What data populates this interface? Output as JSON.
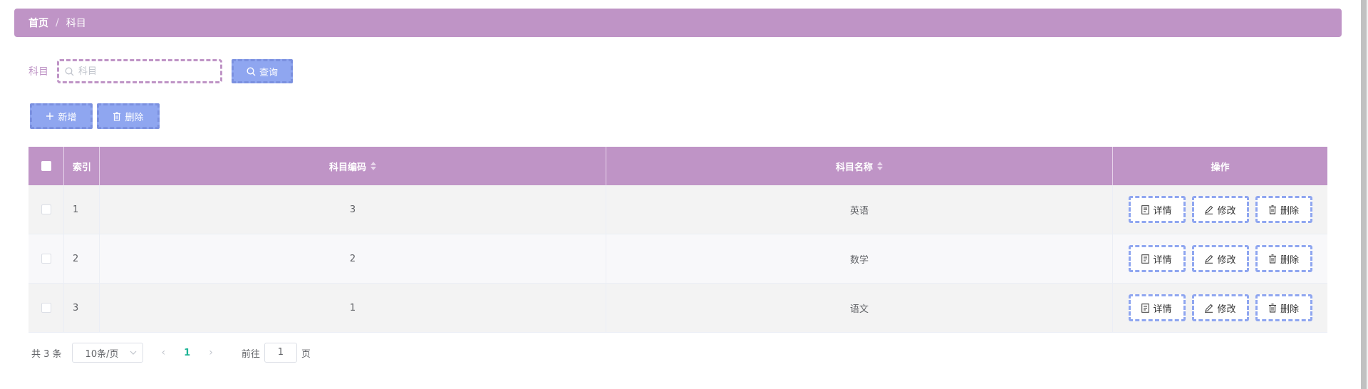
{
  "breadcrumb": {
    "home": "首页",
    "separator": "/",
    "current": "科目"
  },
  "search": {
    "label": "科目",
    "placeholder": "科目",
    "value": "",
    "query_label": "查询"
  },
  "actions": {
    "add_label": "新增",
    "delete_label": "删除"
  },
  "table": {
    "headers": {
      "index": "索引",
      "code": "科目编码",
      "name": "科目名称",
      "ops": "操作"
    },
    "rows": [
      {
        "index": "1",
        "code": "3",
        "name": "英语"
      },
      {
        "index": "2",
        "code": "2",
        "name": "数学"
      },
      {
        "index": "3",
        "code": "1",
        "name": "语文"
      }
    ],
    "row_ops": {
      "detail": "详情",
      "edit": "修改",
      "delete": "删除"
    }
  },
  "pagination": {
    "total_text": "共 3 条",
    "page_size": "10条/页",
    "prev": "‹",
    "current_page": "1",
    "next": "›",
    "goto_prefix": "前往",
    "goto_value": "1",
    "goto_suffix": "页"
  },
  "colors": {
    "header": "#bf94c6",
    "button": "#8fa6f0",
    "active_page": "#1cb394"
  },
  "icons": [
    "search-icon",
    "plus-icon",
    "trash-icon",
    "document-icon",
    "edit-icon",
    "chevron-down-icon"
  ]
}
